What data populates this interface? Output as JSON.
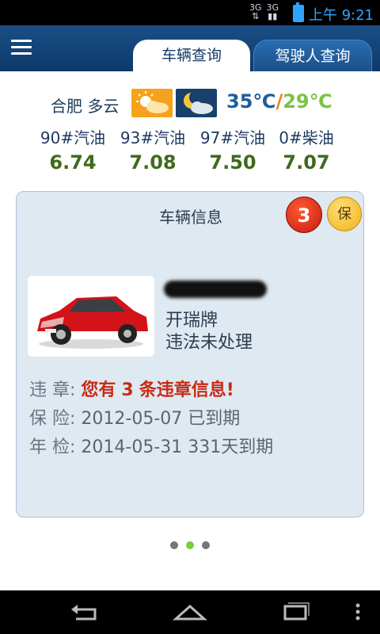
{
  "status_bar": {
    "net1": "3G",
    "net2": "3G",
    "time": "上午 9:21"
  },
  "tabs": [
    {
      "label": "车辆查询",
      "active": true
    },
    {
      "label": "驾驶人查询",
      "active": false
    }
  ],
  "weather": {
    "city": "合肥",
    "condition": "多云",
    "high": "35℃",
    "separator": "/",
    "low": "29℃",
    "icons": [
      "sun-cloud-icon",
      "moon-cloud-icon"
    ]
  },
  "fuel": [
    {
      "name": "90#汽油",
      "price": "6.74"
    },
    {
      "name": "93#汽油",
      "price": "7.08"
    },
    {
      "name": "97#汽油",
      "price": "7.50"
    },
    {
      "name": "0#柴油",
      "price": "7.07"
    }
  ],
  "vehicle_card": {
    "title": "车辆信息",
    "badge_count": "3",
    "badge_insurance": "保",
    "brand": "开瑞牌",
    "status": "违法未处理",
    "violation": {
      "label": "违  章:",
      "prefix": "您有",
      "count": "3",
      "suffix": "条违章信息!"
    },
    "insurance": {
      "label": "保  险:",
      "value": "2012-05-07 已到期"
    },
    "inspection": {
      "label": "年  检:",
      "value": "2014-05-31 331天到期"
    }
  },
  "pager": {
    "pages": 3,
    "active": 1
  },
  "colors": {
    "appbar": "#12406f",
    "accent_green": "#7fca3b",
    "violation_red": "#c62c16"
  }
}
